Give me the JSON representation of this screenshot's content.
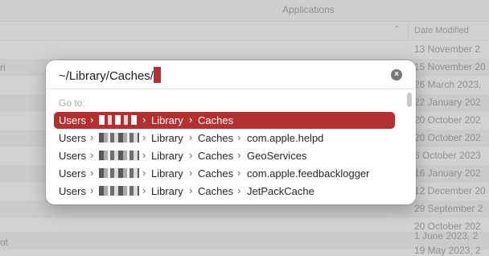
{
  "background": {
    "window_title": "Applications",
    "column_header": "Date Modified",
    "left_fragments": [
      "ri",
      "ot"
    ],
    "dates": [
      "13 November 2",
      "15 November 20",
      "26 March 2023,",
      "22 January 202",
      "20 October 202",
      "20 October 202",
      "6 October 2023",
      "16 January 202",
      "12 December 20",
      "29 September 2",
      "20 October 202",
      "1 June 2023, 2",
      "19 May 2023, 2"
    ]
  },
  "dialog": {
    "path_value": "~/Library/Caches/",
    "goto_label": "Go to:",
    "items": [
      {
        "users": "Users",
        "library": "Library",
        "caches": "Caches",
        "leaf": ""
      },
      {
        "users": "Users",
        "library": "Library",
        "caches": "Caches",
        "leaf": "com.apple.helpd"
      },
      {
        "users": "Users",
        "library": "Library",
        "caches": "Caches",
        "leaf": "GeoServices"
      },
      {
        "users": "Users",
        "library": "Library",
        "caches": "Caches",
        "leaf": "com.apple.feedbacklogger"
      },
      {
        "users": "Users",
        "library": "Library",
        "caches": "Caches",
        "leaf": "JetPackCache"
      }
    ],
    "chevron": "›",
    "clear_symbol": "×",
    "selected_index": 0
  },
  "colors": {
    "selection": "#b23030",
    "caret": "#b53131"
  },
  "icons": [
    "sort-chevron-icon",
    "clear-icon",
    "chevron-right-icon"
  ]
}
